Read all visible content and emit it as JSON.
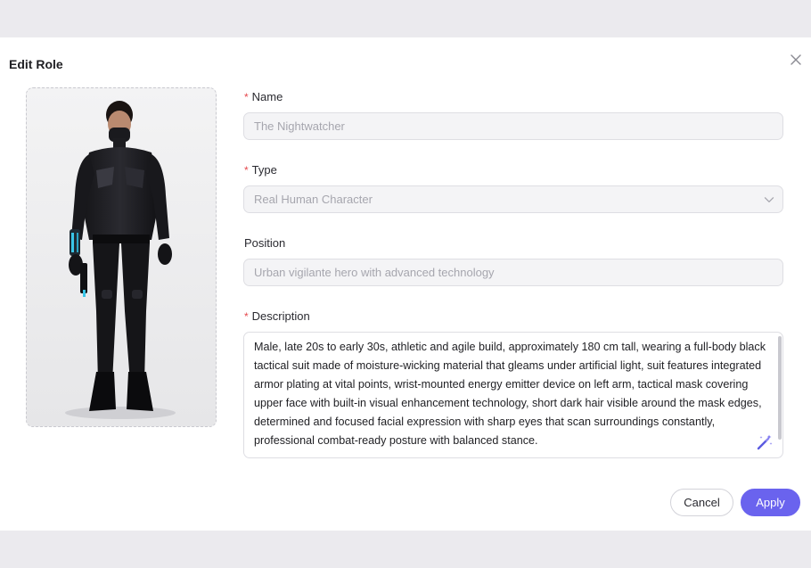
{
  "dialog": {
    "title": "Edit Role",
    "close_icon": "close-icon"
  },
  "image": {
    "alt": "character-photo"
  },
  "form": {
    "name": {
      "required": true,
      "label": "Name",
      "placeholder": "The Nightwatcher"
    },
    "type": {
      "required": true,
      "label": "Type",
      "value": "Real Human Character",
      "icon": "chevron-down-icon"
    },
    "position": {
      "required": false,
      "label": "Position",
      "placeholder": "Urban vigilante hero with advanced technology"
    },
    "description": {
      "required": true,
      "label": "Description",
      "value": "Male, late 20s to early 30s, athletic and agile build, approximately 180 cm tall, wearing a full-body black tactical suit made of moisture-wicking material that gleams under artificial light, suit features integrated armor plating at vital points, wrist-mounted energy emitter device on left arm, tactical mask covering upper face with built-in visual enhancement technology, short dark hair visible around the mask edges, determined and focused facial expression with sharp eyes that scan surroundings constantly, professional combat-ready posture with balanced stance.",
      "icon": "magic-wand-icon"
    }
  },
  "footer": {
    "cancel_label": "Cancel",
    "apply_label": "Apply"
  },
  "colors": {
    "accent": "#6a63ee",
    "required_marker": "#e5484d",
    "backdrop": "#ebeaee"
  }
}
